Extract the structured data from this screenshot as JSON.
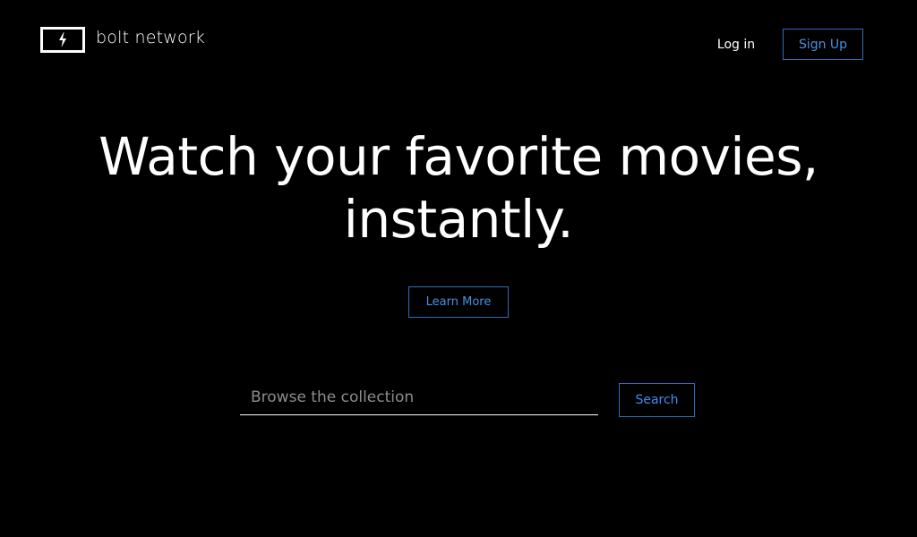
{
  "brand": {
    "name": "bolt network",
    "logo_icon": "lightning-bolt-icon"
  },
  "nav": {
    "login_label": "Log in",
    "signup_label": "Sign Up"
  },
  "hero": {
    "line1": "Watch your favorite movies,",
    "line2": "instantly.",
    "learn_more_label": "Learn More"
  },
  "search": {
    "placeholder": "Browse the collection",
    "value": "",
    "button_label": "Search"
  },
  "colors": {
    "background": "#000000",
    "text": "#ffffff",
    "accent": "#4a90e2",
    "accent_border": "#2f6db8",
    "placeholder": "#8c8c8c"
  }
}
